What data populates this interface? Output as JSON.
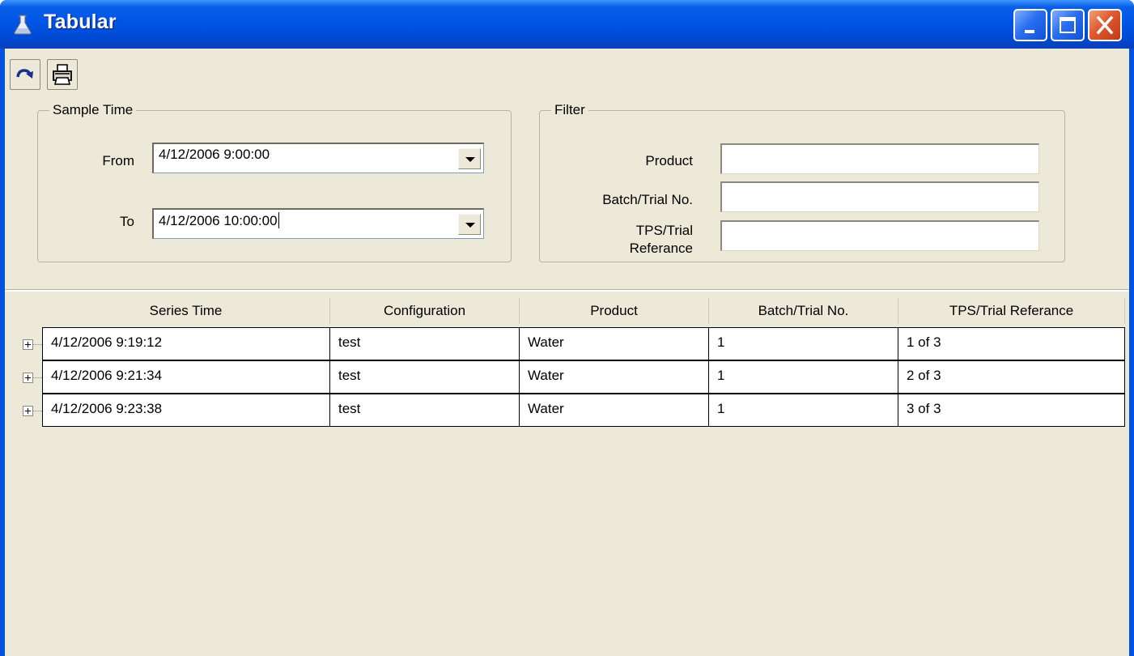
{
  "window": {
    "title": "Tabular",
    "icon": "flask-icon",
    "colors": {
      "titlebar": "#0055e5",
      "client": "#ece9d8",
      "close": "#e0582d"
    }
  },
  "toolbar": {
    "refresh_icon": "refresh-icon",
    "print_icon": "printer-icon"
  },
  "sample_time": {
    "legend": "Sample Time",
    "from_label": "From",
    "from_value": "4/12/2006 9:00:00",
    "to_label": "To",
    "to_value": "4/12/2006 10:00:00"
  },
  "filter": {
    "legend": "Filter",
    "product_label": "Product",
    "product_value": "",
    "batch_label": "Batch/Trial No.",
    "batch_value": "",
    "tps_label_line1": "TPS/Trial",
    "tps_label_line2": "Referance",
    "tps_value": ""
  },
  "grid": {
    "columns": [
      "Series Time",
      "Configuration",
      "Product",
      "Batch/Trial No.",
      "TPS/Trial Referance"
    ],
    "rows": [
      [
        "4/12/2006 9:19:12",
        "test",
        "Water",
        "1",
        "1 of 3"
      ],
      [
        "4/12/2006 9:21:34",
        "test",
        "Water",
        "1",
        "2 of 3"
      ],
      [
        "4/12/2006 9:23:38",
        "test",
        "Water",
        "1",
        "3 of 3"
      ]
    ]
  }
}
